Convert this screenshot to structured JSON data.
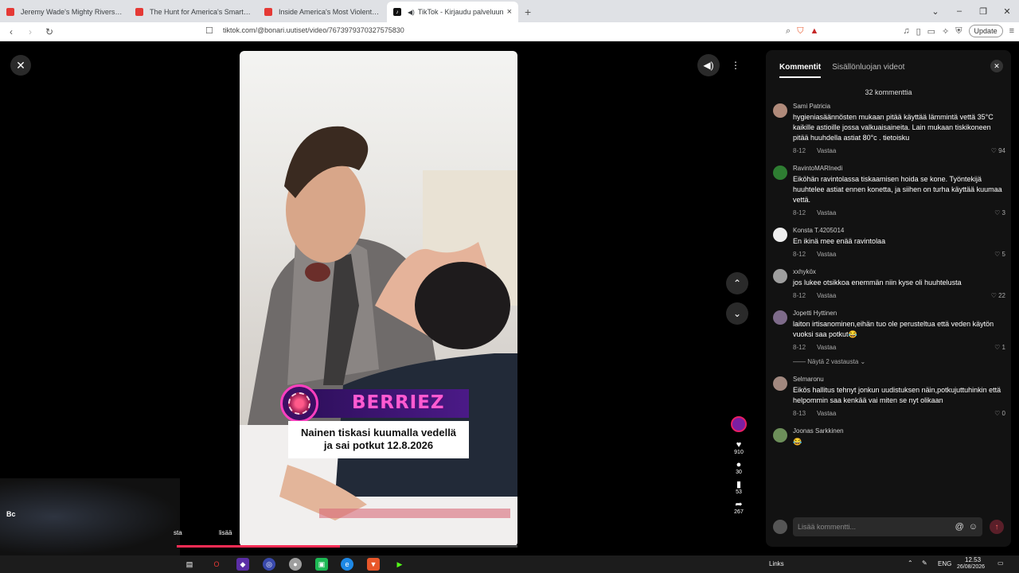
{
  "browser": {
    "tabs": [
      {
        "title": "Jeremy Wade's Mighty Rivers - Full E",
        "icon": "youtube-icon"
      },
      {
        "title": "The Hunt for America's Smartest Kill",
        "icon": "youtube-icon"
      },
      {
        "title": "Inside America's Most Violent Prison",
        "icon": "youtube-icon"
      },
      {
        "title": "TikTok - Kirjaudu palveluun",
        "icon": "tiktok-icon"
      }
    ],
    "url": "tiktok.com/@bonari.uutiset/video/7673979370327575830",
    "update_label": "Update"
  },
  "video": {
    "brand": "BERRIEZ",
    "caption_line1": "Nainen tiskasi kuumalla vedellä",
    "caption_line2": "ja sai potkut 12.8.2026",
    "progress": 0.48
  },
  "actions": {
    "likes": "910",
    "comments": "30",
    "saves": "53",
    "shares": "267"
  },
  "webcam": {
    "t1": "Bc",
    "t2": "sta",
    "lisaa": "lisää"
  },
  "panel": {
    "tab_comments": "Kommentit",
    "tab_creator_videos": "Sisällönluojan videot",
    "count": "32 kommenttia",
    "reply_label": "Vastaa",
    "more_replies": "Näytä 2 vastausta",
    "input_placeholder": "Lisää kommentti...",
    "comments": [
      {
        "user": "Sami Patricia",
        "text": "hygieniasäännösten mukaan pitää käyttää lämmintä vettä 35°C kaikille astioille jossa valkuaisaineita. Lain mukaan tiskikoneen pitää huuhdella astiat 80°c . tietoisku",
        "date": "8-12",
        "likes": "94",
        "color": "#b08a7a"
      },
      {
        "user": "RavintoMARInedi",
        "text": "Eiköhän ravintolassa tiskaamisen hoida se kone. Työntekijä huuhtelee astiat ennen konetta, ja siihen on turha käyttää kuumaa vettä.",
        "date": "8-12",
        "likes": "3",
        "color": "#2e7d32"
      },
      {
        "user": "Konsta T.4205014",
        "text": "En ikinä mee enää ravintolaa",
        "date": "8-12",
        "likes": "5",
        "color": "#eeeeee"
      },
      {
        "user": "xxhyköx",
        "text": "jos lukee otsikkoa enemmän niin kyse oli huuhtelusta",
        "date": "8-12",
        "likes": "22",
        "color": "#9e9e9e"
      },
      {
        "user": "Jopetti Hyttinen",
        "text": "laiton irtisanominen,eihän tuo ole perusteltua että veden käytön vuoksi saa potkut",
        "emoji": "😂",
        "date": "8-12",
        "likes": "1",
        "color": "#7e6b8a"
      },
      {
        "user": "Selmaronu",
        "text": "Eikös hallitus tehnyt jonkun uudistuksen näin,potkujuttuhinkin että helpommin saa kenkää vai miten se nyt olikaan",
        "date": "8-13",
        "likes": "0",
        "color": "#a1887f"
      },
      {
        "user": "Joonas Sarkkinen",
        "text": "😂",
        "date": "",
        "likes": "",
        "color": "#6d8f5a"
      }
    ]
  },
  "taskbar": {
    "links": "Links",
    "lang": "ENG",
    "time": "12.53",
    "date": "26/08/2026"
  }
}
